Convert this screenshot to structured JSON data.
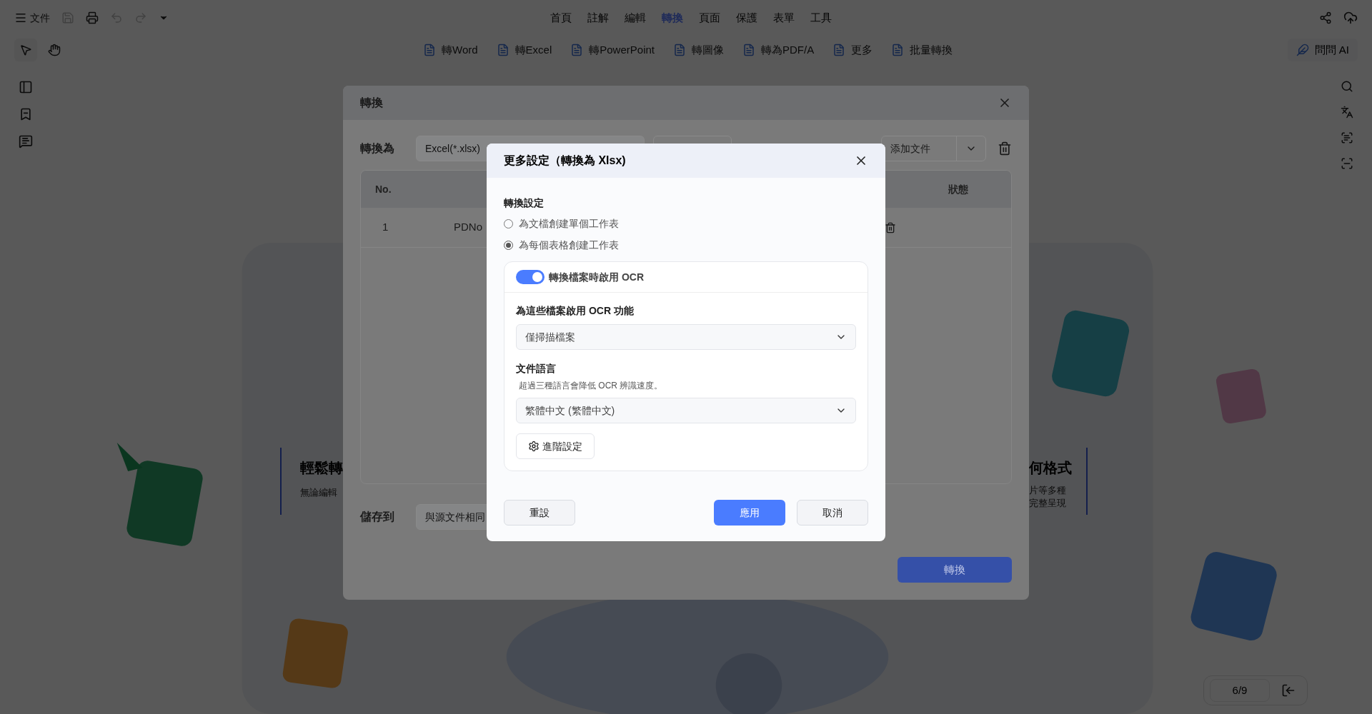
{
  "menu_bar": {
    "file_label": "文件",
    "tabs": [
      {
        "label": "首頁",
        "selected": false
      },
      {
        "label": "註解",
        "selected": false
      },
      {
        "label": "編輯",
        "selected": false
      },
      {
        "label": "轉換",
        "selected": true
      },
      {
        "label": "頁面",
        "selected": false
      },
      {
        "label": "保護",
        "selected": false
      },
      {
        "label": "表單",
        "selected": false
      },
      {
        "label": "工具",
        "selected": false
      }
    ]
  },
  "toolbar": {
    "buttons": [
      "轉Word",
      "轉Excel",
      "轉PowerPoint",
      "轉圖像",
      "轉為PDF/A",
      "更多",
      "批量轉換"
    ],
    "ask_ai": "問問 AI"
  },
  "background_page": {
    "headline_left": "輕鬆轉",
    "body_left": "無論編輯",
    "headline_right": "何格式",
    "body_right": [
      "片等多種",
      "完整呈現"
    ]
  },
  "page_indicator": "6/9",
  "convert_dialog": {
    "title": "轉換",
    "target_label": "轉換為",
    "target_value": "Excel(*.xlsx)",
    "add_file_label": "添加文件",
    "columns": [
      "No.",
      "狀態"
    ],
    "rows": [
      {
        "no": "1",
        "name": "PDNo"
      }
    ],
    "save_label": "儲存到",
    "save_value": "與源文件相同",
    "convert_button": "轉換"
  },
  "settings_dialog": {
    "title": "更多設定（轉換為 Xlsx)",
    "section_title": "轉換設定",
    "options": [
      {
        "label": "為文檔創建單個工作表",
        "selected": false
      },
      {
        "label": "為每個表格創建工作表",
        "selected": true
      }
    ],
    "ocr": {
      "on": true,
      "label": "轉換檔案時啟用 OCR",
      "mode_label": "為這些檔案啟用 OCR 功能",
      "mode_value": "僅掃描檔案",
      "language_label": "文件語言",
      "language_hint": "超過三種語言會降低 OCR 辨識速度。",
      "language_value": "繁體中文 (繁體中文)",
      "advanced_button": "進階設定"
    },
    "buttons": {
      "reset": "重設",
      "apply": "應用",
      "cancel": "取消"
    }
  }
}
